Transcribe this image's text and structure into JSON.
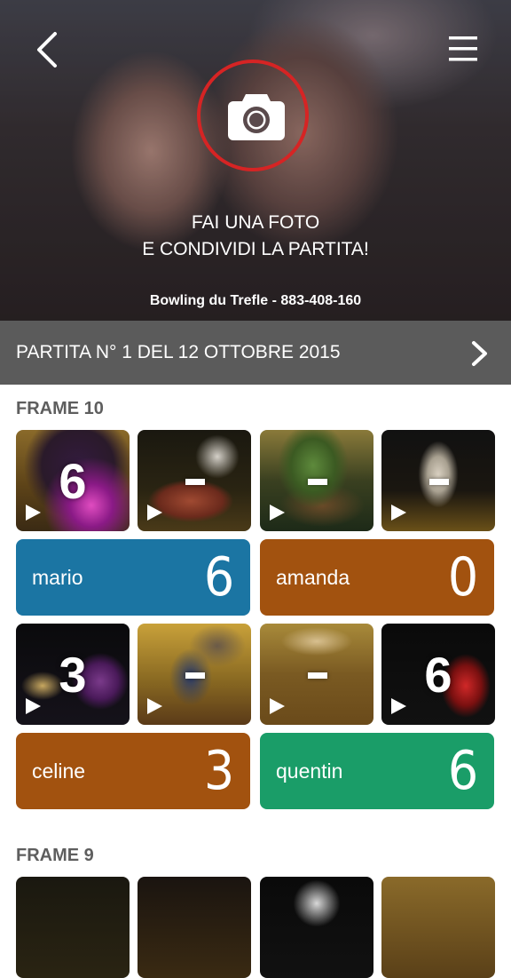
{
  "hero": {
    "cta_line1": "FAI UNA FOTO",
    "cta_line2": "E CONDIVIDI LA PARTITA!",
    "venue": "Bowling du Trefle - 883-408-160"
  },
  "icons": {
    "back": "chevron-left-icon",
    "menu": "hamburger-menu-icon",
    "camera": "camera-icon",
    "next": "chevron-right-icon",
    "play": "play-icon"
  },
  "colors": {
    "camera_ring": "#d62424",
    "bar_bg": "#5b5b5b",
    "player_blue": "#1b75a3",
    "player_brown": "#a2520f",
    "player_green": "#1a9d68"
  },
  "game": {
    "title": "PARTITA N° 1 DEL 12 OTTOBRE 2015"
  },
  "frames": [
    {
      "title": "FRAME 10",
      "rows": [
        {
          "videos": [
            {
              "label": "6"
            },
            {
              "label": "-"
            },
            {
              "label": "-"
            },
            {
              "label": "-"
            }
          ],
          "players": [
            {
              "name": "mario",
              "score": "6",
              "color": "#1b75a3"
            },
            {
              "name": "amanda",
              "score": "0",
              "color": "#a2520f"
            }
          ]
        },
        {
          "videos": [
            {
              "label": "3"
            },
            {
              "label": "-"
            },
            {
              "label": "-"
            },
            {
              "label": "6"
            }
          ],
          "players": [
            {
              "name": "celine",
              "score": "3",
              "color": "#a2520f"
            },
            {
              "name": "quentin",
              "score": "6",
              "color": "#1a9d68"
            }
          ]
        }
      ]
    },
    {
      "title": "FRAME 9"
    }
  ]
}
